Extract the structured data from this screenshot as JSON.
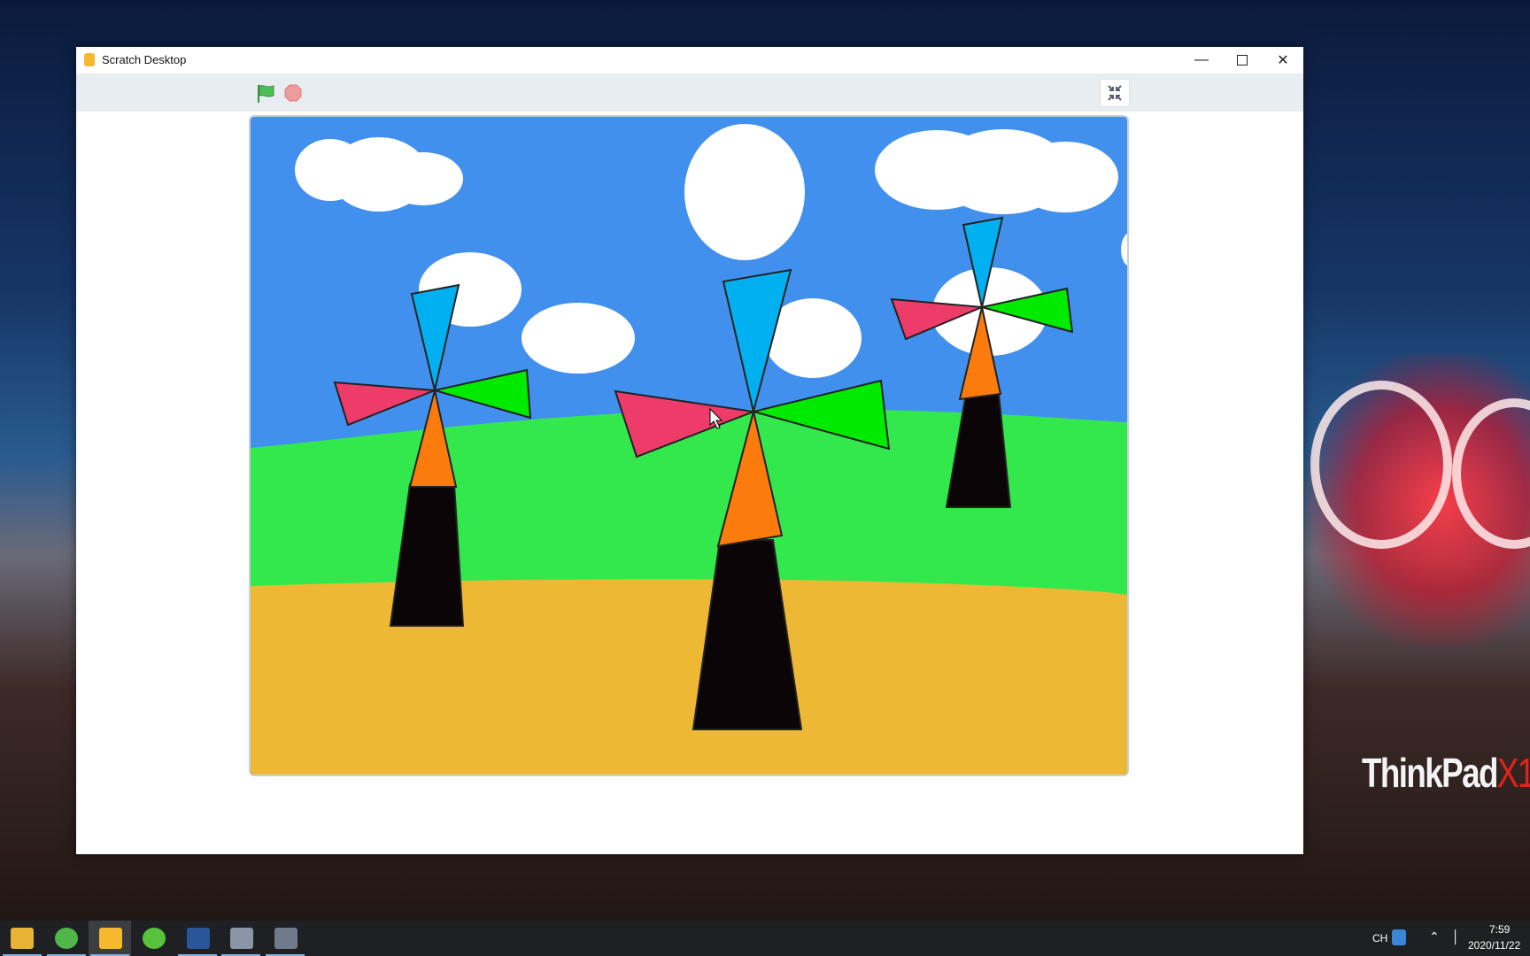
{
  "window": {
    "title": "Scratch Desktop"
  },
  "toolbar": {
    "green_flag": "green-flag-icon",
    "stop": "stop-icon",
    "unfullscreen": "unfullscreen-icon"
  },
  "desktop": {
    "brand_main": "ThinkPad",
    "brand_model": "X1"
  },
  "taskbar": {
    "apps": [
      "file-explorer",
      "browser",
      "scratch-desktop",
      "wechat",
      "word",
      "video-tool-1",
      "video-tool-2"
    ],
    "ime": "CH",
    "time": "7:59",
    "date": "2020/11/22"
  },
  "colors": {
    "sky": "#4290ee",
    "grass": "#33e84c",
    "sand": "#edb833",
    "blade_blue": "#00b0f0",
    "blade_pink": "#ee3c6a",
    "blade_green": "#00ea00",
    "blade_orange": "#fb7c0c"
  }
}
